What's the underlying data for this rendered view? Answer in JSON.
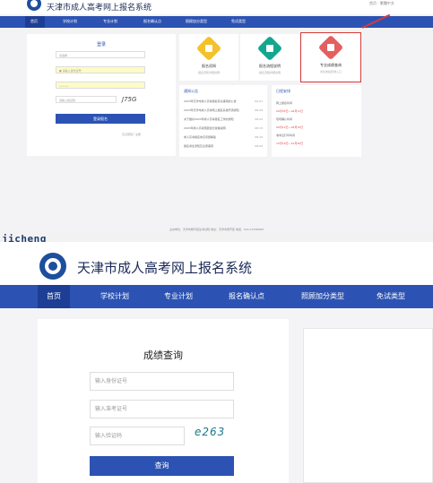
{
  "watermark": "jicheng",
  "top": {
    "title": "天津市成人高考网上报名系统",
    "header_right": "首页 · 繁體中文",
    "nav": [
      "首页",
      "学校计划",
      "专业计划",
      "报名确认点",
      "照顾加分类型",
      "免试类型"
    ],
    "login": {
      "title": "登录",
      "field1": "请选择",
      "field2": "● 请输入身份证号",
      "field3": "••••••",
      "field4": "请输入验证码",
      "captcha": "J75G",
      "button": "登录报名",
      "link": "忘记密码？注册"
    },
    "tiles": [
      {
        "title": "报名须知",
        "sub": "报名须知详细说明"
      },
      {
        "title": "报名流程说明",
        "sub": "报名流程详细说明"
      },
      {
        "title": "专业成绩查询",
        "sub": "考生成绩查询入口"
      }
    ],
    "news": {
      "title": "通知公告",
      "rows": [
        {
          "text": "2023年天津市成人高考报名有关事项的公告",
          "date": "09-01"
        },
        {
          "text": "2023年天津市成人高考网上报名系统开通通知",
          "date": "08-28"
        },
        {
          "text": "关于做好2023年成人高考报名工作的通知",
          "date": "08-20"
        },
        {
          "text": "2023年成人高考照顾加分政策说明",
          "date": "08-15"
        },
        {
          "text": "成人高考报名常见问题解答",
          "date": "08-10"
        },
        {
          "text": "报名考生须知及注意事项",
          "date": "08-05"
        }
      ]
    },
    "schedule": {
      "title": "日程安排",
      "rows": [
        {
          "text": "网上报名时间",
          "red": false
        },
        {
          "text": "09月05日—09月11日",
          "red": true
        },
        {
          "text": "现场确认时间",
          "red": false
        },
        {
          "text": "09月12日—09月15日",
          "red": true
        },
        {
          "text": "准考证打印时间",
          "red": false
        },
        {
          "text": "10月16日—10月20日",
          "red": true
        }
      ]
    },
    "footer": "主办单位：天津市教育招生考试院    地址：天津市南开区    电话：022-23766666"
  },
  "bottom": {
    "title": "天津市成人高考网上报名系统",
    "nav": [
      "首页",
      "学校计划",
      "专业计划",
      "报名确认点",
      "照顾加分类型",
      "免试类型"
    ],
    "query": {
      "title": "成绩查询",
      "id_placeholder": "输入身份证号",
      "ticket_placeholder": "输入准考证号",
      "captcha_placeholder": "输入验证码",
      "captcha": "e263",
      "button": "查询"
    }
  }
}
